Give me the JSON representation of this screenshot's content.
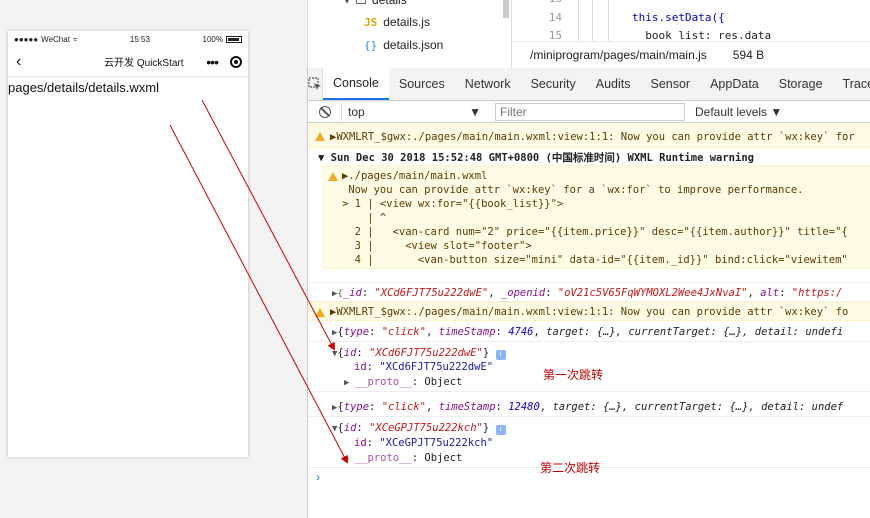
{
  "phone": {
    "carrier": "WeChat",
    "signal": "●●●●●",
    "time": "15:53",
    "battery": "100%",
    "nav_back": "‹",
    "nav_title": "云开发 QuickStart",
    "nav_dots": "•••",
    "page_path": "pages/details/details.wxml"
  },
  "filetree": {
    "folder": "details",
    "files": [
      {
        "badge": "JS",
        "name": "details.js"
      },
      {
        "badge": "{}",
        "name": "details.json"
      }
    ]
  },
  "editor": {
    "lines": [
      {
        "num": "13",
        "code": ""
      },
      {
        "num": "14",
        "code": "this.setData({"
      },
      {
        "num": "15",
        "code": "  book_list: res.data"
      }
    ],
    "file_path": "/miniprogram/pages/main/main.js",
    "file_size": "594 B"
  },
  "devtools": {
    "tabs": [
      "Console",
      "Sources",
      "Network",
      "Security",
      "Audits",
      "Sensor",
      "AppData",
      "Storage",
      "Trace"
    ],
    "active_tab": "Console",
    "context": "top",
    "filter_placeholder": "Filter",
    "levels": "Default levels ▼"
  },
  "console": {
    "warn1": "▶WXMLRT_$gwx:./pages/main/main.wxml:view:1:1: Now you can provide attr `wx:key` for",
    "group_head": "▼ Sun Dec 30 2018 15:52:48 GMT+0800 (中国标准时间) WXML Runtime warning",
    "group_file": "▶./pages/main/main.wxml",
    "group_msg": " Now you can provide attr `wx:key` for a `wx:for` to improve performance.",
    "code_lines": [
      "> 1 | <view wx:for=\"{{book_list}}\">",
      "    | ^",
      "  2 |   <van-card num=\"2\" price=\"{{item.price}}\" desc=\"{{item.author}}\" title=\"{",
      "  3 |     <view slot=\"footer\">",
      "  4 |       <van-button size=\"mini\" data-id=\"{{item._id}}\" bind:click=\"viewitem\""
    ],
    "obj1": {
      "prefix": "▶{",
      "k1": "_id",
      "v1": "\"XCd6FJT75u222dwE\"",
      "k2": "_openid",
      "v2": "\"oV21c5V65FqWYMOXL2Wee4JxNvaI\"",
      "k3": "alt",
      "v3": "\"https:/"
    },
    "warn2": "▶WXMLRT_$gwx:./pages/main/main.wxml:view:1:1: Now you can provide attr `wx:key` fo",
    "event1": {
      "type": "\"click\"",
      "ts": "4746",
      "rest": "target: {…}, currentTarget: {…}, detail: undefi"
    },
    "id1": {
      "head": "\"XCd6FJT75u222dwE\"",
      "val": "\"XCd6FJT75u222dwE\"",
      "proto": "__proto__",
      "protoval": "Object"
    },
    "event2": {
      "type": "\"click\"",
      "ts": "12480",
      "rest": "target: {…}, currentTarget: {…}, detail: undef"
    },
    "id2": {
      "head": "\"XCeGPJT75u222kch\"",
      "val": "\"XCeGPJT75u222kch\"",
      "proto": "__proto__",
      "protoval": "Object"
    },
    "prompt": "›"
  },
  "annotations": {
    "first": "第一次跳转",
    "second": "第二次跳转"
  },
  "colors": {
    "accent": "#1a73e8",
    "warning_bg": "#fffbe5",
    "arrow": "#cc0000"
  }
}
